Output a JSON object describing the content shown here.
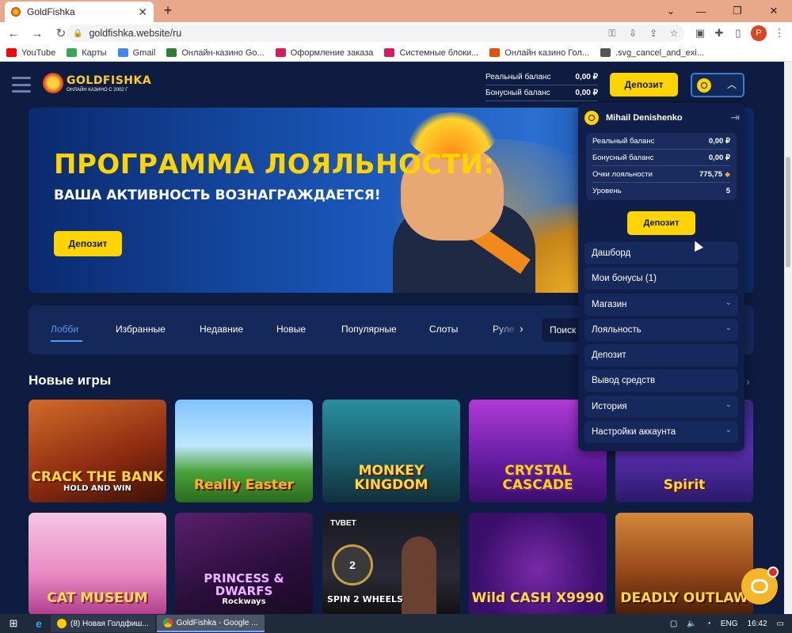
{
  "browser": {
    "tab_title": "GoldFishka",
    "tab_close": "✕",
    "new_tab": "+",
    "win_controls": {
      "chevron": "⌄",
      "minimize": "—",
      "restore": "❐",
      "close": "✕"
    },
    "url": "goldfishka.website/ru",
    "nav": {
      "back": "←",
      "forward": "→",
      "reload": "↻"
    },
    "profile_initial": "P",
    "bookmarks": [
      {
        "label": "YouTube",
        "color": "#ff0000"
      },
      {
        "label": "Карты",
        "color": "#34a853"
      },
      {
        "label": "Gmail",
        "color": "#4285f4"
      },
      {
        "label": "Онлайн-казино Go...",
        "color": "#2e7d32"
      },
      {
        "label": "Оформление заказа",
        "color": "#d81b60"
      },
      {
        "label": "Системные блоки...",
        "color": "#d81b60"
      },
      {
        "label": "Онлайн казино Гол...",
        "color": "#e65100"
      },
      {
        "label": ".svg_cancel_and_exi...",
        "color": "#555555"
      }
    ]
  },
  "site": {
    "logo": {
      "name": "GOLDFISHKA",
      "subtitle": "ОНЛАЙН КАЗИНО С 2002 Г"
    },
    "header": {
      "real_balance_label": "Реальный баланс",
      "real_balance_value": "0,00 ₽",
      "bonus_balance_label": "Бонусный баланс",
      "bonus_balance_value": "0,00 ₽",
      "deposit_label": "Депозит",
      "caret": "︿"
    },
    "banner": {
      "title": "ПРОГРАММА ЛОЯЛЬНОСТИ:",
      "subtitle": "ВАША АКТИВНОСТЬ ВОЗНАГРАЖДАЕТСЯ!",
      "deposit_label": "Депозит"
    },
    "categories": [
      "Лобби",
      "Избранные",
      "Недавние",
      "Новые",
      "Популярные",
      "Слоты",
      "Руле"
    ],
    "active_category": "Лобби",
    "category_arrow": "›",
    "search_placeholder": "Поиск",
    "section_title": "Новые игры",
    "section_arrow": "›",
    "games": [
      {
        "name": "CRACK THE BANK",
        "tagline": "HOLD AND WIN"
      },
      {
        "name": "Really Easter",
        "tagline": ""
      },
      {
        "name": "MONKEY KINGDOM",
        "tagline": ""
      },
      {
        "name": "CRYSTAL CASCADE",
        "tagline": ""
      },
      {
        "name": "Spirit",
        "tagline": ""
      },
      {
        "name": "CAT MUSEUM",
        "tagline": ""
      },
      {
        "name": "PRINCESS & DWARFS",
        "tagline": "Rockways"
      },
      {
        "name": "SPIN 2 WHEELS",
        "tagline": "",
        "brand": "TVBET",
        "wheel": "2"
      },
      {
        "name": "Wild CASH X9990",
        "tagline": ""
      },
      {
        "name": "DEADLY OUTLAW",
        "tagline": ""
      }
    ]
  },
  "account_menu": {
    "username": "Mihail Denishenko",
    "logout_icon": "⇥",
    "stats": {
      "real_balance_label": "Реальный баланс",
      "real_balance_value": "0,00 ₽",
      "bonus_balance_label": "Бонусный баланс",
      "bonus_balance_value": "0,00 ₽",
      "loyalty_label": "Очки лояльности",
      "loyalty_value": "775,75",
      "level_label": "Уровень",
      "level_value": "5"
    },
    "deposit_label": "Депозит",
    "items": [
      {
        "label": "Дашборд",
        "chevron": ""
      },
      {
        "label": "Мои бонусы (1)",
        "chevron": ""
      },
      {
        "label": "Магазин",
        "chevron": "⌄"
      },
      {
        "label": "Лояльность",
        "chevron": "⌄"
      },
      {
        "label": "Депозит",
        "chevron": ""
      },
      {
        "label": "Вывод средств",
        "chevron": ""
      },
      {
        "label": "История",
        "chevron": "⌄"
      },
      {
        "label": "Настройки аккаунта",
        "chevron": "⌄"
      }
    ]
  },
  "taskbar": {
    "start_icon": "⊞",
    "ie_icon": "e",
    "apps": [
      {
        "label": "(8) Новая Голдфиш...",
        "active": false
      },
      {
        "label": "GoldFishka - Google ...",
        "active": true
      }
    ],
    "language": "ENG",
    "time": "16:42"
  },
  "colors": {
    "brand_yellow": "#ffd400",
    "site_bg": "#0e1c41",
    "accent_blue": "#4f9bff"
  }
}
